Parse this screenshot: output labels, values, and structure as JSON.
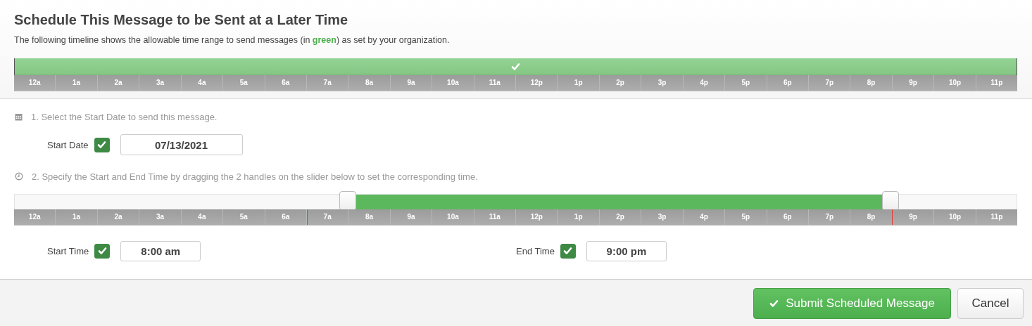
{
  "title": "Schedule This Message to be Sent at a Later Time",
  "description": "The following timeline shows the allowable time range to send messages (in **green**) as set by your organization.",
  "timeline": {
    "allowed": {
      "level": 1
    },
    "hours": [
      "12a",
      "1a",
      "2a",
      "3a",
      "4a",
      "5a",
      "6a",
      "7a",
      "8a",
      "9a",
      "10a",
      "11a",
      "12p",
      "1p",
      "2p",
      "3p",
      "4p",
      "5p",
      "6p",
      "7p",
      "8p",
      "9p",
      "10p",
      "11p"
    ]
  },
  "step_1": {
    "text": "1. Select the Start Date to send this message.",
    "start_date": {
      "label": "Start Date",
      "checked": true,
      "value": "07/13/2021"
    }
  },
  "step_2": {
    "text": "2. Specify the Start and End Time by dragging the 2 handles on the slider below to set the corresponding time.",
    "slider": {
      "start": {
        "level": 0.3333
      },
      "end": {
        "level": 0.875
      },
      "limit_markers": [
        {
          "level": 0.2917
        },
        {
          "level": 0.875
        }
      ],
      "hours": [
        "12a",
        "1a",
        "2a",
        "3a",
        "4a",
        "5a",
        "6a",
        "7a",
        "8a",
        "9a",
        "10a",
        "11a",
        "12p",
        "1p",
        "2p",
        "3p",
        "4p",
        "5p",
        "6p",
        "7p",
        "8p",
        "9p",
        "10p",
        "11p"
      ]
    },
    "start_time": {
      "label": "Start Time",
      "checked": true,
      "value": "8:00 am"
    },
    "end_time": {
      "label": "End Time",
      "checked": true,
      "value": "9:00 pm"
    }
  },
  "buttons": {
    "submit": "Submit Scheduled Message",
    "cancel": "Cancel"
  }
}
